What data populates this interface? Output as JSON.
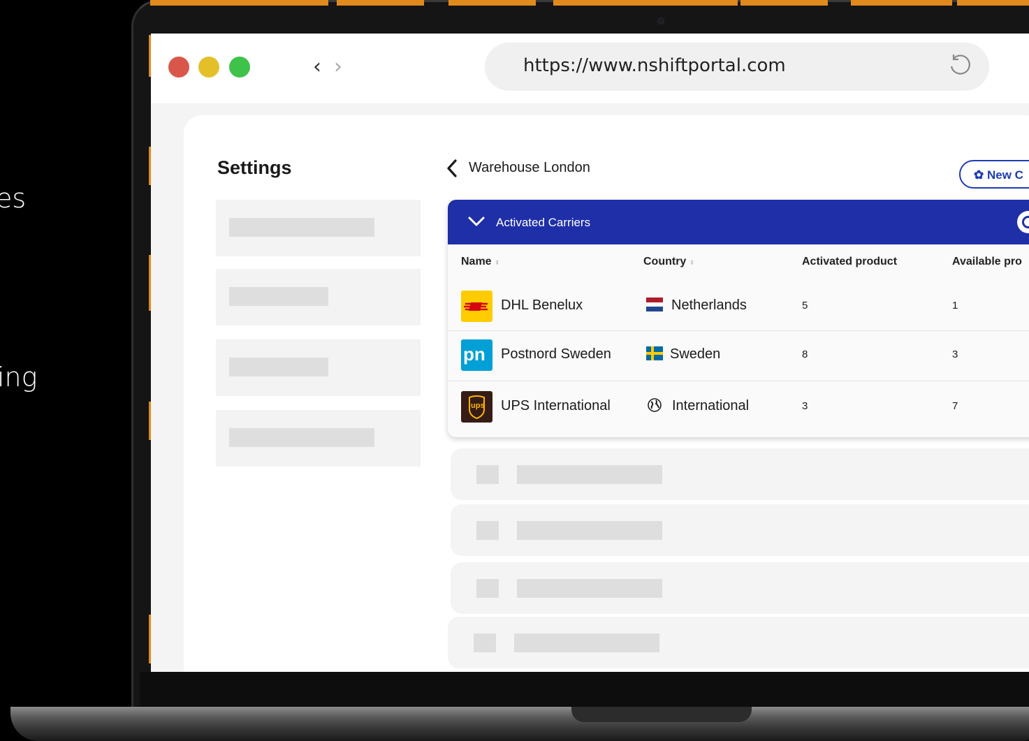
{
  "side_text": [
    "es",
    "ing"
  ],
  "browser": {
    "url": "https://www.nshiftportal.com",
    "dot_colors": [
      "#d9574a",
      "#e3c02a",
      "#3ec24a"
    ]
  },
  "sidebar": {
    "title": "Settings"
  },
  "header": {
    "breadcrumb": "Warehouse London",
    "new_button_label": "New C"
  },
  "panel": {
    "title": "Activated Carriers",
    "columns": [
      "Name",
      "Country",
      "Activated product",
      "Available pro"
    ],
    "rows": [
      {
        "logo": "dhl-logo",
        "name": "DHL Benelux",
        "flag": "netherlands-flag-icon",
        "country": "Netherlands",
        "activated": "5",
        "available": "1"
      },
      {
        "logo": "postnord-logo",
        "name": "Postnord Sweden",
        "flag": "sweden-flag-icon",
        "country": "Sweden",
        "activated": "8",
        "available": "3"
      },
      {
        "logo": "ups-logo",
        "name": "UPS International",
        "flag": "globe-icon",
        "country": "International",
        "activated": "3",
        "available": "7"
      }
    ]
  },
  "logo_text": {
    "pn": "pn",
    "ups": "ups"
  },
  "colors": {
    "accent": "#1f2fa8",
    "dhl_yellow": "#ffcc00",
    "dhl_red": "#d40511",
    "postnord_blue": "#00a0d6",
    "ups_brown": "#351c15",
    "ups_gold": "#ffb500"
  }
}
